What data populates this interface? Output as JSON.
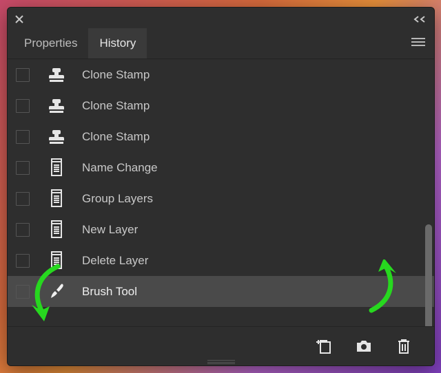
{
  "tabs": {
    "properties": "Properties",
    "history": "History",
    "active": "history"
  },
  "history": [
    {
      "label": "Clone Stamp",
      "icon": "stamp",
      "selected": false
    },
    {
      "label": "Clone Stamp",
      "icon": "stamp",
      "selected": false
    },
    {
      "label": "Clone Stamp",
      "icon": "stamp",
      "selected": false
    },
    {
      "label": "Name Change",
      "icon": "document",
      "selected": false
    },
    {
      "label": "Group Layers",
      "icon": "document",
      "selected": false
    },
    {
      "label": "New Layer",
      "icon": "document",
      "selected": false
    },
    {
      "label": "Delete Layer",
      "icon": "document",
      "selected": false
    },
    {
      "label": "Brush Tool",
      "icon": "brush",
      "selected": true
    }
  ],
  "footer_icons": [
    "new-from-state",
    "snapshot",
    "delete"
  ],
  "colors": {
    "panel": "#2e2e2e",
    "selected": "#4a4a4a",
    "text": "#c8c8c8",
    "annotation": "#27d81f"
  }
}
